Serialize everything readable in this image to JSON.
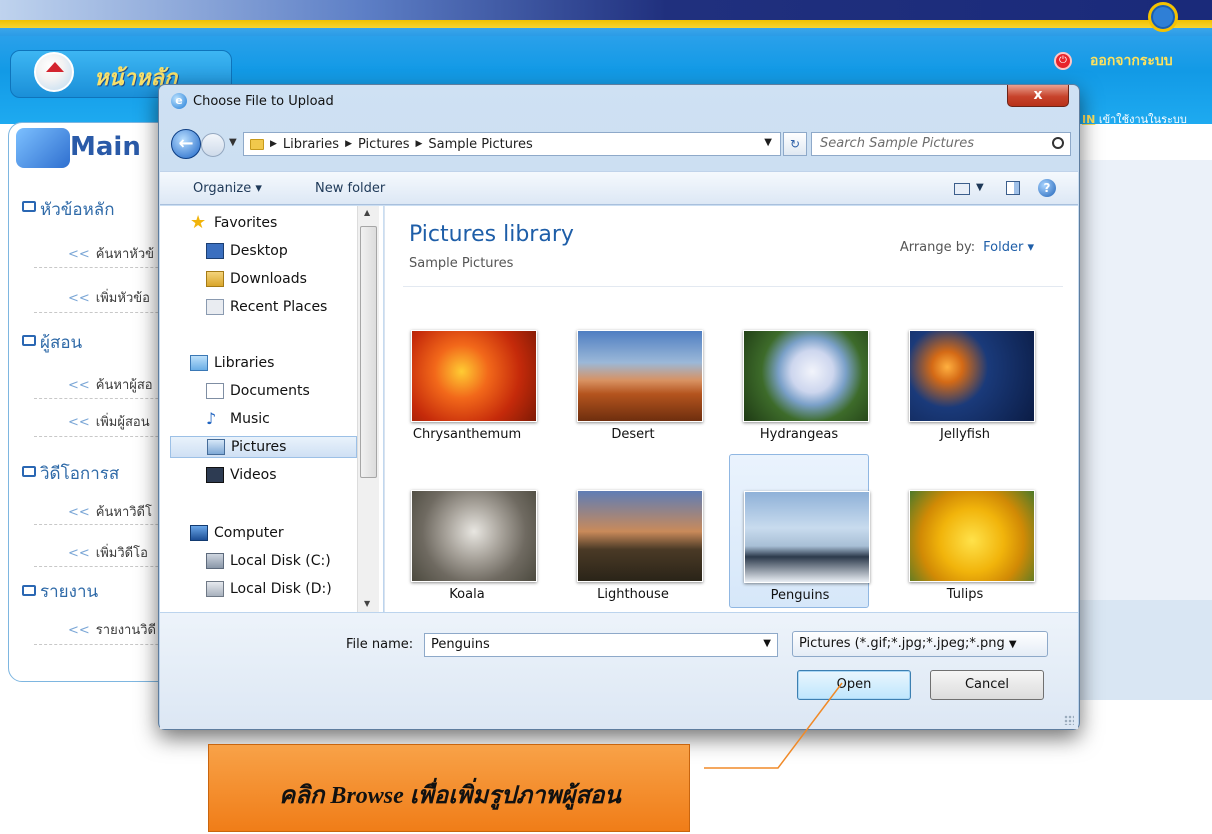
{
  "app": {
    "home_label": "หน้าหลัก",
    "logout_label": "ออกจากระบบ",
    "user_name": "IN",
    "user_status": "เข้าใช้งานในระบบ",
    "main_title": "Main",
    "sidebar": {
      "sections": [
        {
          "label": "หัวข้อหลัก",
          "items": [
            "ค้นหาหัวข้",
            "เพิ่มหัวข้อ"
          ]
        },
        {
          "label": "ผู้สอน",
          "items": [
            "ค้นหาผู้สอ",
            "เพิ่มผู้สอน"
          ]
        },
        {
          "label": "วิดีโอการส",
          "items": [
            "ค้นหาวิดีโ",
            "เพิ่มวิดีโอ"
          ]
        },
        {
          "label": "รายงาน",
          "items": [
            "รายงานวิดี"
          ]
        }
      ],
      "arrow": "<<"
    }
  },
  "dialog": {
    "title": "Choose File to Upload",
    "close_label": "x",
    "breadcrumb": [
      "Libraries",
      "Pictures",
      "Sample Pictures"
    ],
    "search_placeholder": "Search Sample Pictures",
    "toolbar": {
      "organize": "Organize ▾",
      "new_folder": "New folder"
    },
    "nav": {
      "favorites": "Favorites",
      "desktop": "Desktop",
      "downloads": "Downloads",
      "recent": "Recent Places",
      "libraries": "Libraries",
      "documents": "Documents",
      "music": "Music",
      "pictures": "Pictures",
      "videos": "Videos",
      "computer": "Computer",
      "disk_c": "Local Disk (C:)",
      "disk_d": "Local Disk (D:)"
    },
    "library_title": "Pictures library",
    "library_sub": "Sample Pictures",
    "arrange_label": "Arrange by:",
    "arrange_value": "Folder ▾",
    "files": [
      "Chrysanthemum",
      "Desert",
      "Hydrangeas",
      "Jellyfish",
      "Koala",
      "Lighthouse",
      "Penguins",
      "Tulips"
    ],
    "selected_file": "Penguins",
    "file_name_label": "File name:",
    "file_name_value": "Penguins",
    "filter_value": "Pictures (*.gif;*.jpg;*.jpeg;*.png",
    "open_label": "Open",
    "cancel_label": "Cancel"
  },
  "annotation": {
    "text": "คลิก Browse เพื่อเพิ่มรูปภาพผู้สอน",
    "color": "#f08a28"
  }
}
